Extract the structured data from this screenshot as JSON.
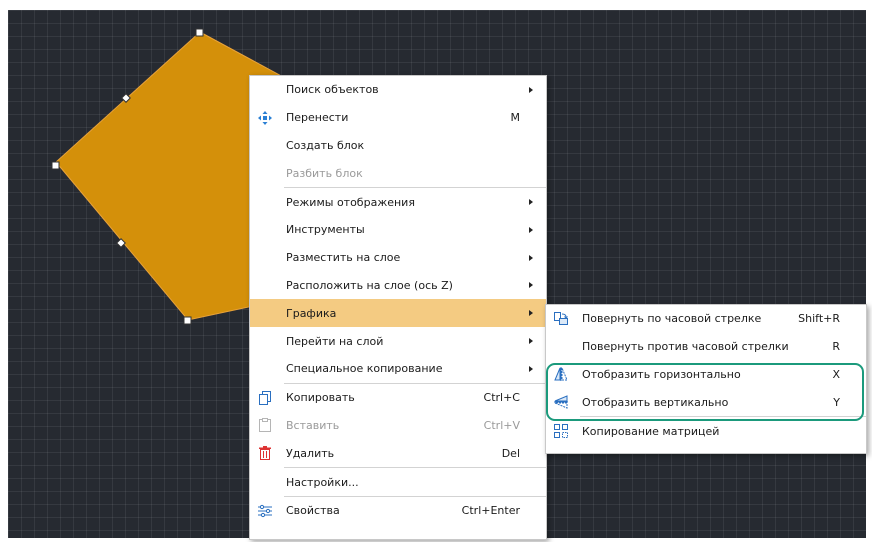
{
  "colors": {
    "canvas_bg": "#262a31",
    "shape_fill": "#d4900a",
    "highlight_color": "#f4cb82",
    "annotation_border": "#1b9a7c"
  },
  "context_menu": {
    "items": [
      {
        "label": "Поиск объектов",
        "has_submenu": true
      },
      {
        "label": "Перенести",
        "shortcut": "M",
        "icon": "move-icon"
      },
      {
        "label": "Создать блок"
      },
      {
        "label": "Разбить блок",
        "disabled": true
      },
      {
        "label": "Режимы отображения",
        "has_submenu": true
      },
      {
        "label": "Инструменты",
        "has_submenu": true
      },
      {
        "label": "Разместить на слое",
        "has_submenu": true
      },
      {
        "label": "Расположить на слое (ось Z)",
        "has_submenu": true
      },
      {
        "label": "Графика",
        "has_submenu": true,
        "highlighted": true
      },
      {
        "label": "Перейти на слой",
        "has_submenu": true
      },
      {
        "label": "Специальное копирование",
        "has_submenu": true
      },
      {
        "label": "Копировать",
        "shortcut": "Ctrl+C",
        "icon": "copy-icon"
      },
      {
        "label": "Вставить",
        "shortcut": "Ctrl+V",
        "icon": "paste-icon",
        "disabled": true
      },
      {
        "label": "Удалить",
        "shortcut": "Del",
        "icon": "trash-icon"
      },
      {
        "label": "Настройки..."
      },
      {
        "label": "Свойства",
        "shortcut": "Ctrl+Enter",
        "icon": "sliders-icon"
      }
    ]
  },
  "graphics_submenu": {
    "items": [
      {
        "label": "Повернуть по часовой стрелке",
        "shortcut": "Shift+R",
        "icon": "rotate-clockwise-icon"
      },
      {
        "label": "Повернуть против часовой стрелки",
        "shortcut": "R"
      },
      {
        "label": "Отобразить горизонтально",
        "shortcut": "X",
        "icon": "flip-horizontal-icon"
      },
      {
        "label": "Отобразить вертикально",
        "shortcut": "Y",
        "icon": "flip-vertical-icon"
      },
      {
        "label": "Копирование матрицей",
        "icon": "matrix-copy-icon"
      }
    ]
  }
}
